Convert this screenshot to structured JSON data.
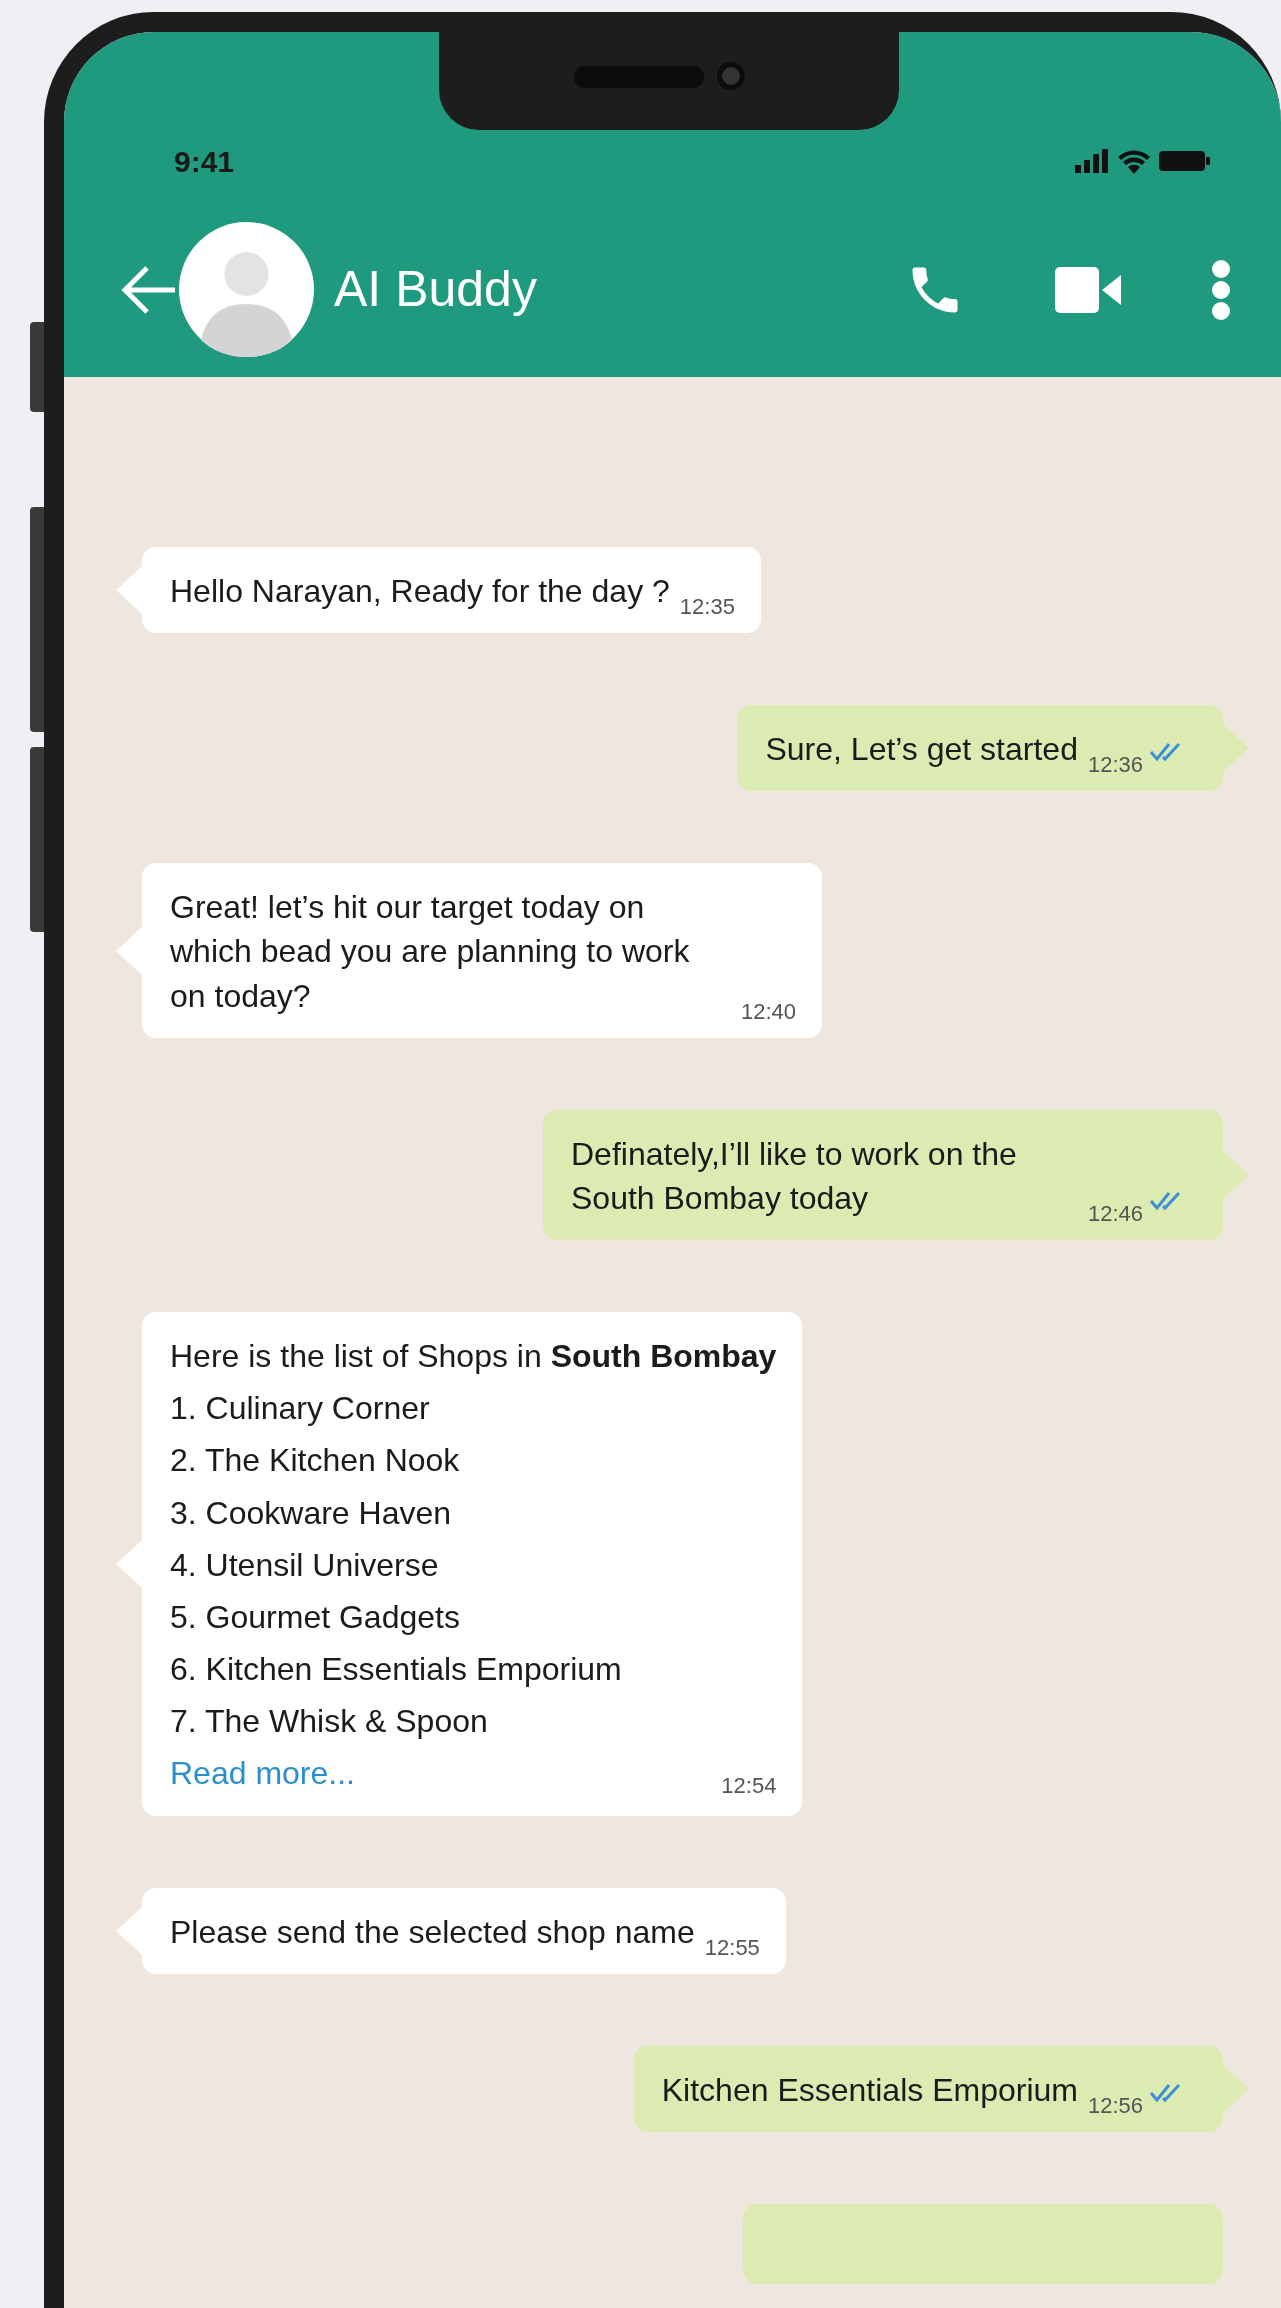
{
  "status_bar": {
    "time": "9:41"
  },
  "header": {
    "title": "AI Buddy"
  },
  "messages": [
    {
      "kind": "incoming",
      "text": "Hello Narayan, Ready for the day ?",
      "time": "12:35"
    },
    {
      "kind": "outgoing",
      "text": "Sure, Let’s get started",
      "time": "12:36",
      "read": true
    },
    {
      "kind": "incoming",
      "text": "Great! let’s hit our target today on which bead you are planning to work on today?",
      "time": "12:40"
    },
    {
      "kind": "outgoing",
      "text": "Definately,I’ll like to work on the South Bombay today",
      "time": "12:46",
      "read": true
    },
    {
      "kind": "list",
      "text": "Here is the list of Shops in **South Bombay**",
      "items": [
        "1. Culinary Corner",
        "2. The Kitchen Nook",
        "3. Cookware Haven",
        "4. Utensil Universe",
        "5. Gourmet Gadgets",
        "6. Kitchen Essentials Emporium",
        "7. The Whisk & Spoon"
      ],
      "link": "Read more...",
      "time": "12:54"
    },
    {
      "kind": "incoming",
      "text": "Please send the selected shop name",
      "time": "12:55"
    },
    {
      "kind": "outgoing",
      "text": "Kitchen Essentials Emporium",
      "time": "12:56",
      "read": true
    },
    {
      "kind": "partial"
    }
  ]
}
